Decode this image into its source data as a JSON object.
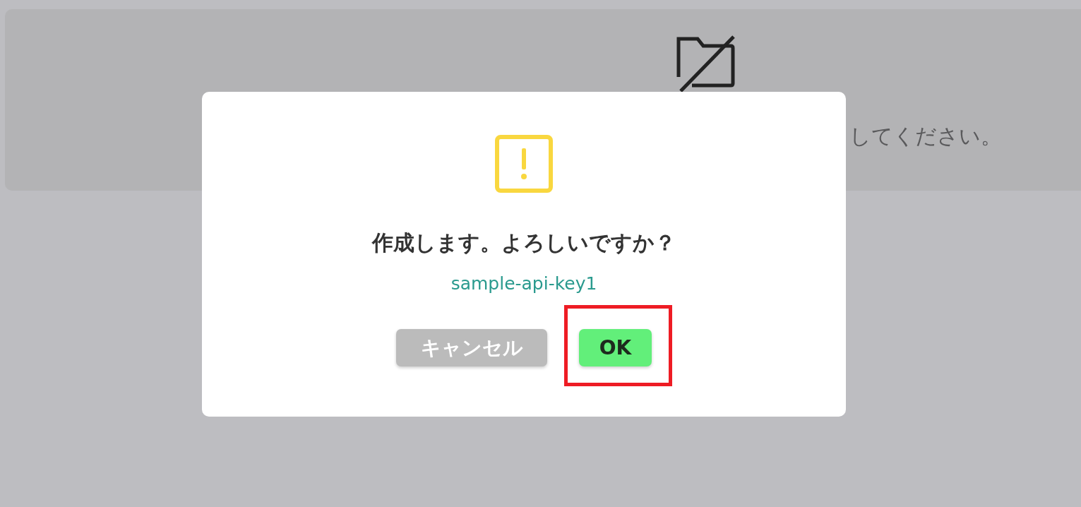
{
  "background_card": {
    "message": "してください。"
  },
  "dialog": {
    "title": "作成します。よろしいですか？",
    "key_name": "sample-api-key1",
    "buttons": [
      {
        "label": "キャンセル",
        "kind": "cancel",
        "highlighted": false
      },
      {
        "label": "OK",
        "kind": "ok",
        "highlighted": true
      }
    ]
  }
}
